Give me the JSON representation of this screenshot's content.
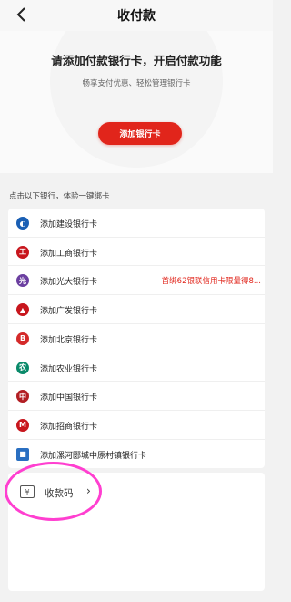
{
  "header": {
    "title": "收付款",
    "back_icon": "chevron-left-icon"
  },
  "hero": {
    "title": "请添加付款银行卡，开启付款功能",
    "subtitle": "畅享支付优惠、轻松管理银行卡",
    "button_label": "添加银行卡",
    "button_color": "#e1251b"
  },
  "section": {
    "hint": "点击以下银行，体验一键绑卡"
  },
  "banks": [
    {
      "label": "添加建设银行卡",
      "icon": "ccb-logo-icon",
      "color": "#1a5fb4",
      "glyph": "◐"
    },
    {
      "label": "添加工商银行卡",
      "icon": "icbc-logo-icon",
      "color": "#c8161d",
      "glyph": "工"
    },
    {
      "label": "添加光大银行卡",
      "icon": "ceb-logo-icon",
      "color": "#6b3fa0",
      "glyph": "光",
      "promo": "首绑62银联信用卡限量得8..."
    },
    {
      "label": "添加广发银行卡",
      "icon": "cgb-logo-icon",
      "color": "#c8161d",
      "glyph": "▲"
    },
    {
      "label": "添加北京银行卡",
      "icon": "bob-logo-icon",
      "color": "#d42a2a",
      "glyph": "B"
    },
    {
      "label": "添加农业银行卡",
      "icon": "abc-logo-icon",
      "color": "#0a8a6a",
      "glyph": "农"
    },
    {
      "label": "添加中国银行卡",
      "icon": "boc-logo-icon",
      "color": "#b21e23",
      "glyph": "中"
    },
    {
      "label": "添加招商银行卡",
      "icon": "cmb-logo-icon",
      "color": "#c8161d",
      "glyph": "M"
    },
    {
      "label": "添加漯河郾城中原村镇银行卡",
      "icon": "rural-bank-logo-icon",
      "color": "#2a6fc1",
      "glyph": "■"
    }
  ],
  "bottom": {
    "label": "收款码",
    "icon": "yuan-qr-icon",
    "glyph": "¥",
    "chevron": "›"
  }
}
